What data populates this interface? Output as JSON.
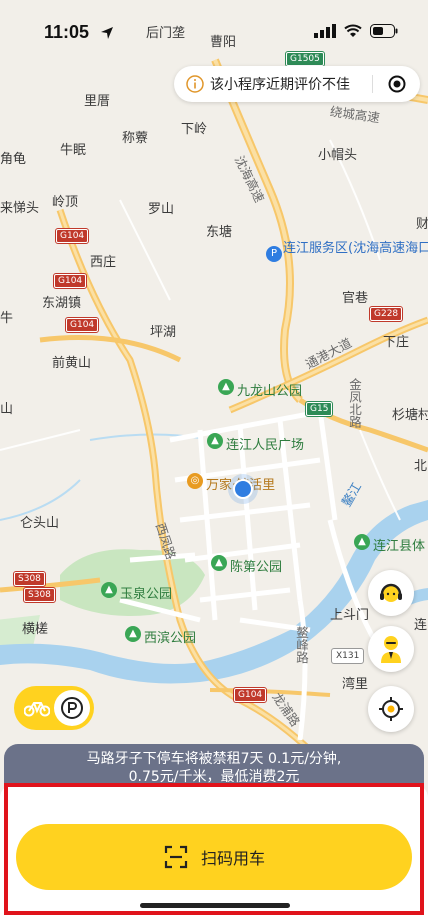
{
  "status_bar": {
    "time": "11:05"
  },
  "notice": {
    "text": "该小程序近期评价不佳"
  },
  "map": {
    "place_labels": [
      "后门垄",
      "曹阳",
      "里厝",
      "称藔",
      "下岭",
      "牛眠",
      "小帽头",
      "岭顶",
      "罗山",
      "东塘",
      "西庄",
      "东湖镇",
      "坪湖",
      "前黄山",
      "官巷",
      "下庄",
      "仑头山",
      "横槎",
      "上斗门",
      "湾里",
      "杉塘村",
      "北",
      "财"
    ],
    "edge_labels": [
      "角龟",
      "来悌头",
      "牛",
      "山",
      "连"
    ],
    "road_labels": [
      "沈海高速",
      "绕城高速",
      "通港大道",
      "金凤北路",
      "西凤路",
      "鳌峰路",
      "龙浦路",
      "鳌江"
    ],
    "shields": [
      "G1505",
      "G104",
      "G104",
      "G104",
      "G15",
      "G228",
      "S308",
      "S308",
      "X131",
      "G104"
    ],
    "pois": [
      "连江服务区(沈海高速海口方向)",
      "九龙山公园",
      "连江人民广场",
      "万家·鲸活里",
      "陈第公园",
      "玉泉公园",
      "西滨公园",
      "连江县体"
    ]
  },
  "banner": {
    "line1": "马路牙子下停车将被禁租7天 0.1元/分钟,",
    "line2": "0.75元/千米，最低消费2元"
  },
  "scan_button": {
    "label": "扫码用车"
  }
}
